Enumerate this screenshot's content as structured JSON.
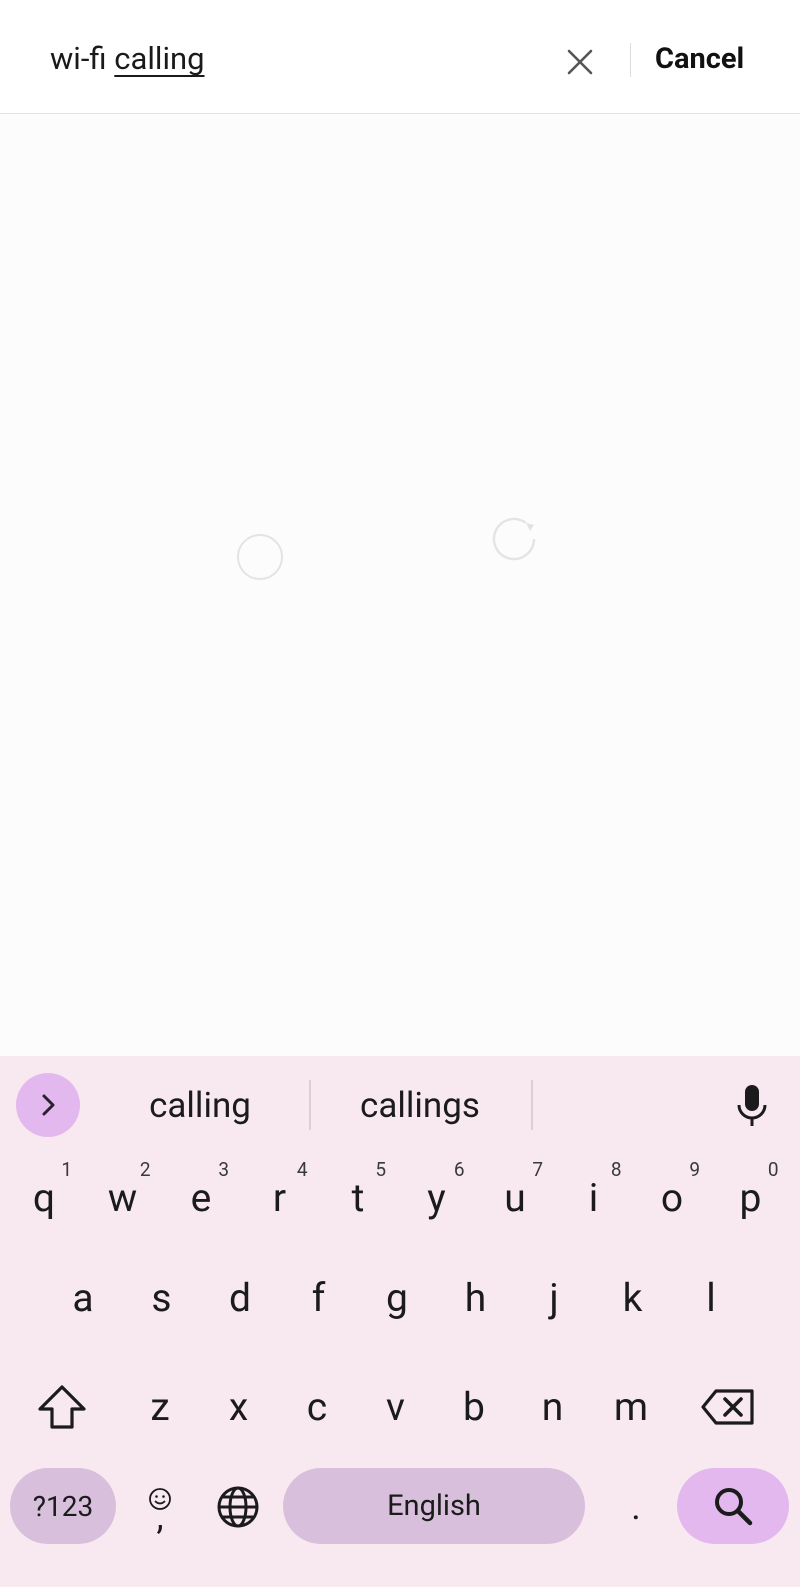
{
  "search": {
    "query_prefix": "wi-fi ",
    "query_composing": "calling",
    "cancel_label": "Cancel"
  },
  "keyboard": {
    "suggestions": [
      "calling",
      "callings"
    ],
    "row1": [
      {
        "k": "q",
        "h": "1"
      },
      {
        "k": "w",
        "h": "2"
      },
      {
        "k": "e",
        "h": "3"
      },
      {
        "k": "r",
        "h": "4"
      },
      {
        "k": "t",
        "h": "5"
      },
      {
        "k": "y",
        "h": "6"
      },
      {
        "k": "u",
        "h": "7"
      },
      {
        "k": "i",
        "h": "8"
      },
      {
        "k": "o",
        "h": "9"
      },
      {
        "k": "p",
        "h": "0"
      }
    ],
    "row2": [
      "a",
      "s",
      "d",
      "f",
      "g",
      "h",
      "j",
      "k",
      "l"
    ],
    "row3": [
      "z",
      "x",
      "c",
      "v",
      "b",
      "n",
      "m"
    ],
    "symbols_label": "?123",
    "emoji_comma_label": ",",
    "space_label": "English",
    "period_label": "."
  },
  "icons": {
    "clear": "close-icon",
    "expand": "chevron-right-icon",
    "mic": "microphone-icon",
    "shift": "shift-icon",
    "backspace": "backspace-icon",
    "emoji": "emoji-icon",
    "globe": "globe-icon",
    "search": "search-icon"
  },
  "colors": {
    "keyboard_bg": "#f8e9f1",
    "accent": "#e3b8ef",
    "key_dark": "#d8bfdc"
  }
}
